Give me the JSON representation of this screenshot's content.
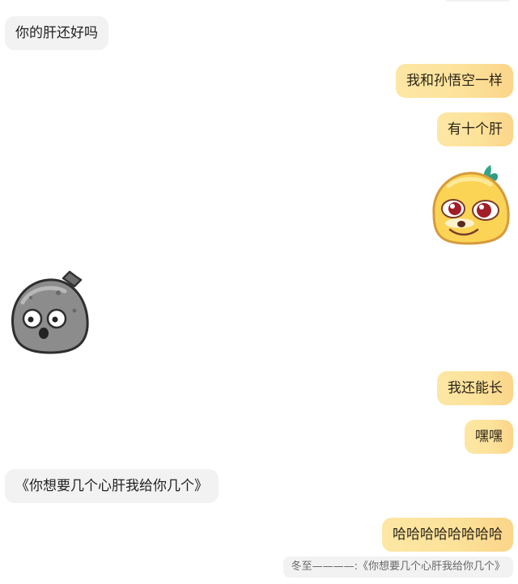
{
  "messages": [
    {
      "side": "in",
      "text": "你的肝还好吗"
    },
    {
      "side": "out",
      "text": "我和孙悟空一样"
    },
    {
      "side": "out",
      "text": "有十个肝"
    },
    {
      "side": "out",
      "sticker": "yellow-blob-sticker"
    },
    {
      "side": "in",
      "sticker": "grey-stone-sticker"
    },
    {
      "side": "out",
      "text": "我还能长"
    },
    {
      "side": "out",
      "text": "嘿嘿"
    },
    {
      "side": "in",
      "text": "《你想要几个心肝我给你几个》"
    },
    {
      "side": "out",
      "text": "哈哈哈哈哈哈哈哈"
    }
  ],
  "reply_quote": {
    "text": "冬至————:《你想要几个心肝我给你几个》"
  },
  "colors": {
    "incoming_bubble": "#f2f2f2",
    "outgoing_bubble": "#fde29a",
    "background": "#ffffff"
  }
}
